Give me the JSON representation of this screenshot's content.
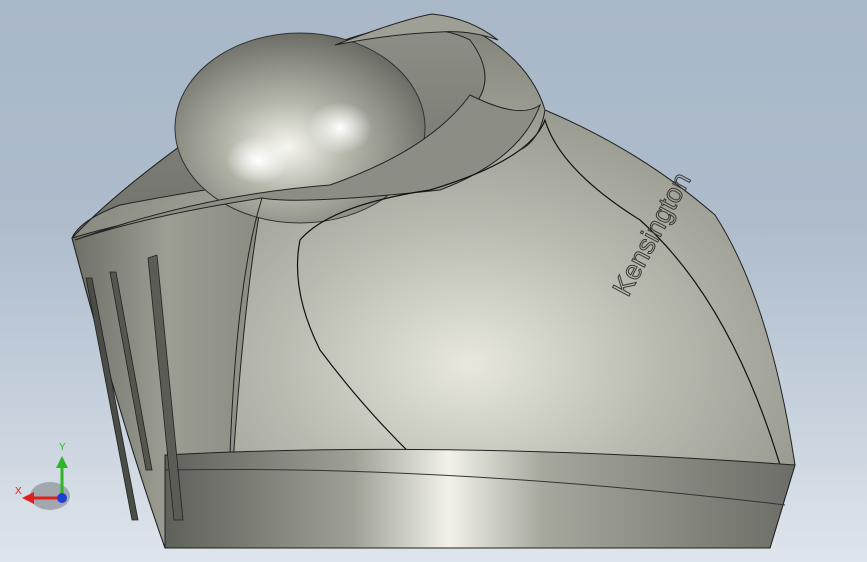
{
  "viewport": {
    "background_top": "#a9b8c9",
    "background_bottom": "#dfe5ec"
  },
  "model": {
    "brand_text": "Kensington",
    "body_color": "#9fa196",
    "ball_color": "#c9c9bc"
  },
  "triad": {
    "x_label": "X",
    "y_label": "Y",
    "x_color": "#e0201c",
    "y_color": "#2fb52a",
    "z_color": "#1d3fd6"
  }
}
